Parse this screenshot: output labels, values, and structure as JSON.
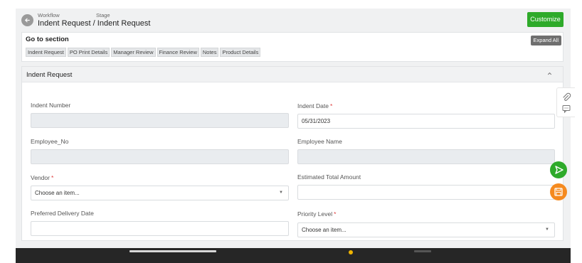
{
  "header": {
    "crumb_workflow": "Workflow",
    "crumb_stage": "Stage",
    "title": "Indent Request / Indent Request",
    "customize_label": "Customize"
  },
  "goto": {
    "title": "Go to section",
    "expand_label": "Expand All",
    "chips": [
      "Indent Request",
      "PO Print Details",
      "Manager Review",
      "Finance Review",
      "Notes",
      "Product Details"
    ]
  },
  "panel": {
    "title": "Indent Request",
    "fields": {
      "indent_number": {
        "label": "Indent Number",
        "value": ""
      },
      "indent_date": {
        "label": "Indent Date",
        "value": "05/31/2023"
      },
      "employee_no": {
        "label": "Employee_No",
        "value": ""
      },
      "employee_name": {
        "label": "Employee Name",
        "value": ""
      },
      "vendor": {
        "label": "Vendor",
        "placeholder": "Choose an item..."
      },
      "estimated_total": {
        "label": "Estimated Total Amount",
        "value": ""
      },
      "preferred_delivery": {
        "label": "Preferred Delivery Date",
        "value": ""
      },
      "priority_level": {
        "label": "Priority Level",
        "placeholder": "Choose an item..."
      }
    },
    "required_mark": "*"
  },
  "icons": {
    "back": "arrow-left-icon",
    "collapse": "chevron-up-icon",
    "attach": "paperclip-icon",
    "comment": "comment-icon",
    "send": "send-icon",
    "save": "save-icon",
    "dropdown": "caret-down-icon"
  },
  "colors": {
    "primary_green": "#2eaa2a",
    "save_orange": "#f58a1f",
    "required_red": "#e04040"
  }
}
